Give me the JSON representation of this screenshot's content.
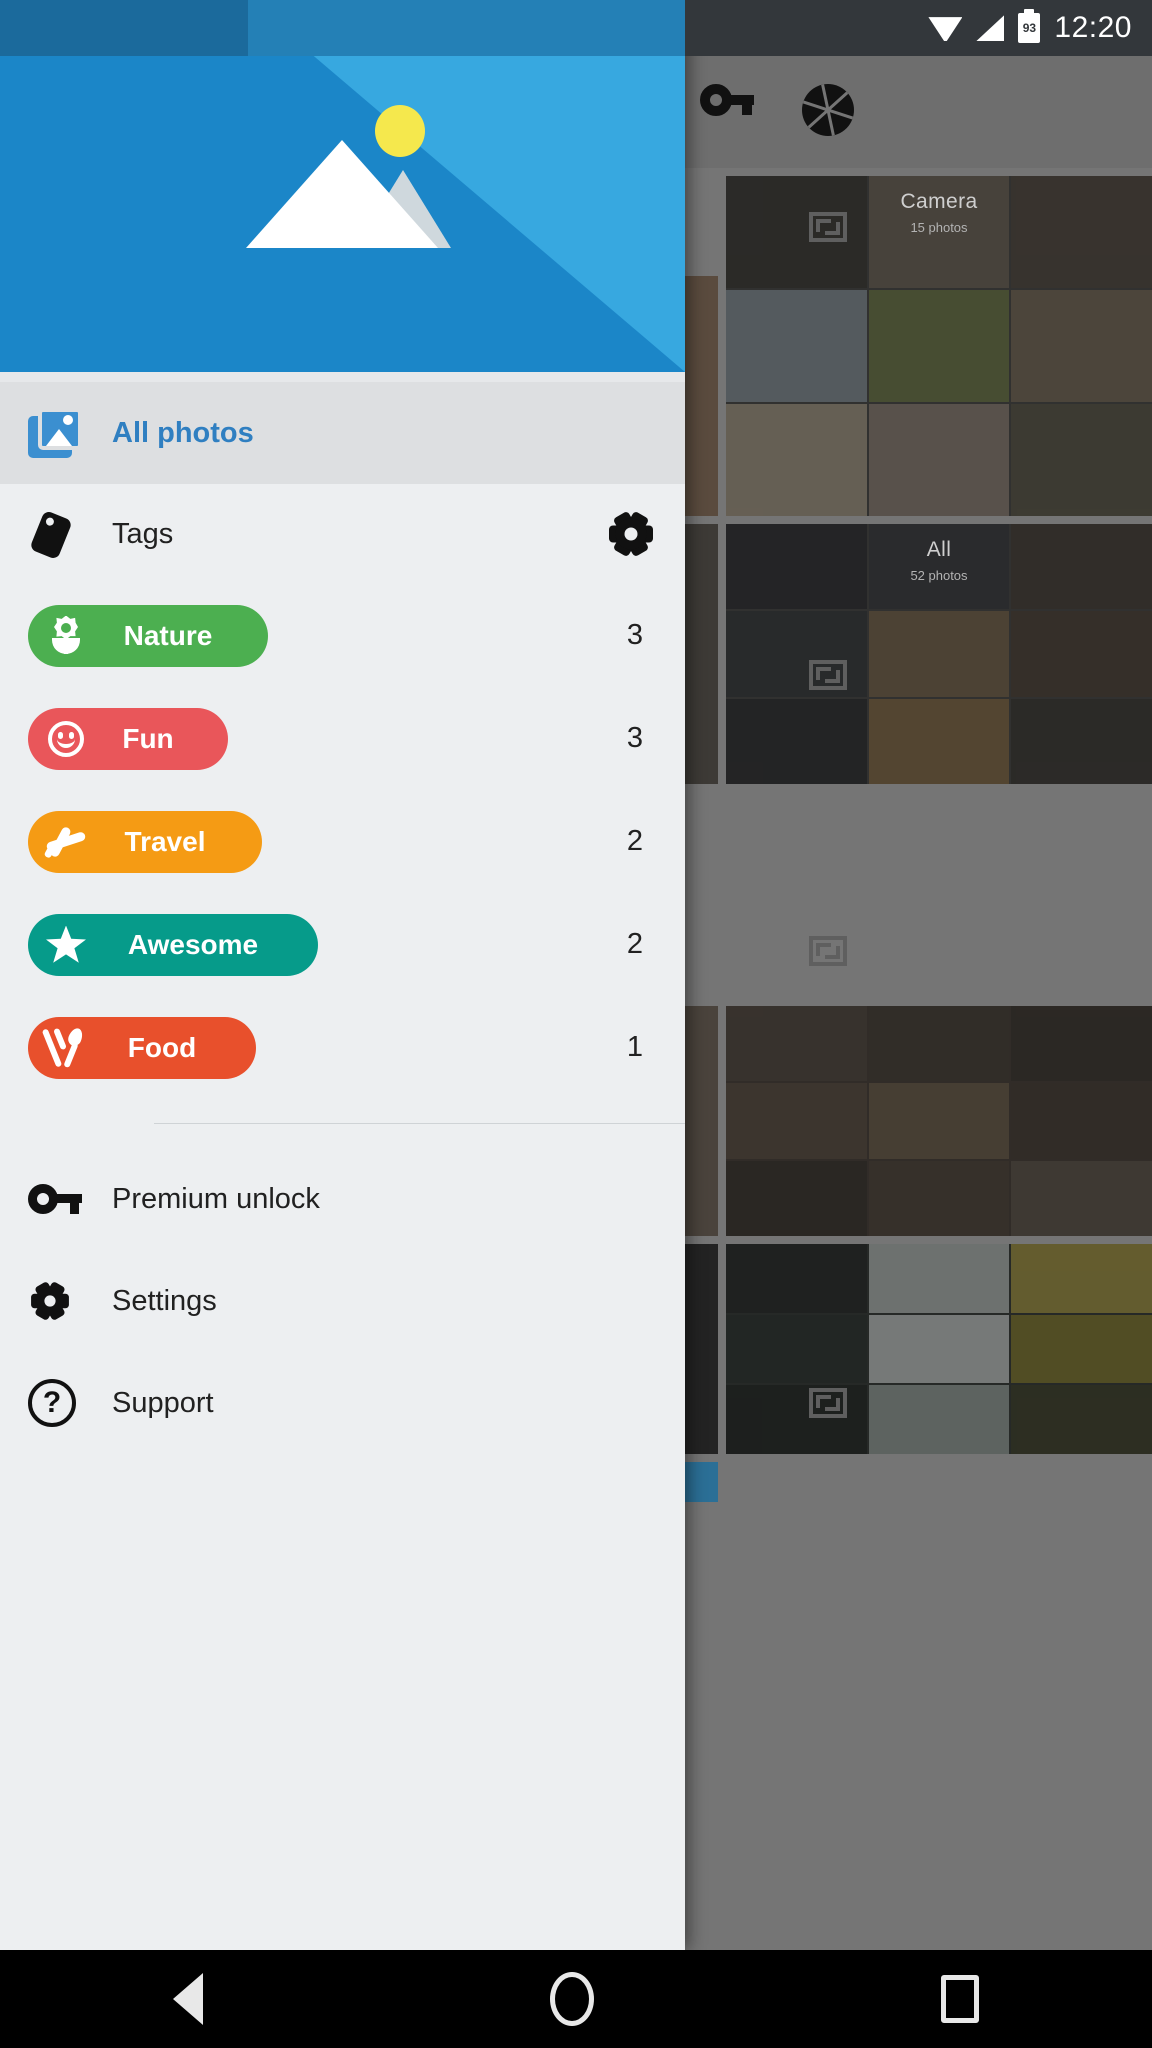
{
  "status_bar": {
    "time": "12:20",
    "battery_percent": "93",
    "icons": [
      "wifi-icon",
      "cell-signal-icon",
      "battery-icon"
    ]
  },
  "drawer": {
    "header": {
      "name": "drawer-header-illustration",
      "icons": [
        "mountain-icon",
        "sun-icon"
      ],
      "colors": {
        "dark_blue": "#1b86c8",
        "light_blue": "#37a8e0",
        "sun": "#f5e84d",
        "mountain": "#ffffff"
      }
    },
    "all_photos": {
      "label": "All photos",
      "icon": "photo-library-icon",
      "selected": true,
      "accent_color": "#2f7fc1"
    },
    "tags_section": {
      "label": "Tags",
      "icon": "tag-icon",
      "settings_icon": "gear-icon"
    },
    "tags": [
      {
        "label": "Nature",
        "count": "3",
        "color": "#4caf50",
        "icon": "flower-icon"
      },
      {
        "label": "Fun",
        "count": "3",
        "color": "#e9565a",
        "icon": "smiley-icon"
      },
      {
        "label": "Travel",
        "count": "2",
        "color": "#f59b14",
        "icon": "airplane-icon"
      },
      {
        "label": "Awesome",
        "count": "2",
        "color": "#069b8a",
        "icon": "star-icon"
      },
      {
        "label": "Food",
        "count": "1",
        "color": "#e8502c",
        "icon": "fork-spoon-icon"
      }
    ],
    "menu": [
      {
        "label": "Premium unlock",
        "icon": "key-icon"
      },
      {
        "label": "Settings",
        "icon": "gear-icon"
      },
      {
        "label": "Support",
        "icon": "question-circle-icon"
      }
    ]
  },
  "background_app": {
    "toolbar_icons": [
      "key-icon",
      "camera-aperture-icon"
    ],
    "expand_icon": "expand-icon",
    "albums": [
      {
        "title": "Camera",
        "subtitle": "15 photos"
      },
      {
        "title": "All",
        "subtitle": "52 photos"
      }
    ]
  },
  "nav_bar": {
    "buttons": [
      {
        "name": "back-button",
        "icon": "triangle-back-icon"
      },
      {
        "name": "home-button",
        "icon": "circle-home-icon"
      },
      {
        "name": "recents-button",
        "icon": "square-recents-icon"
      }
    ]
  }
}
